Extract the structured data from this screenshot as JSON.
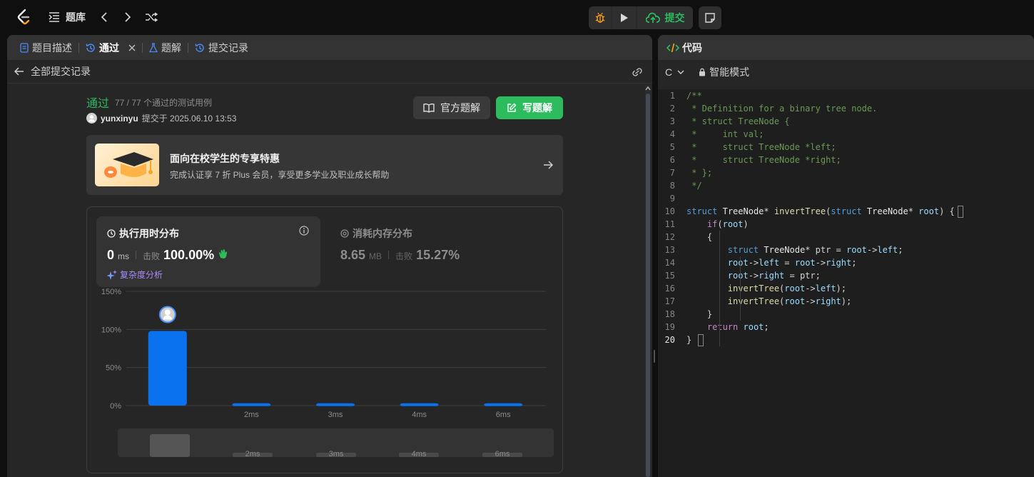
{
  "topbar": {
    "problem_bank": "题库",
    "submit": "提交",
    "colors": {
      "submit_green": "#2cbb5d",
      "debug_orange": "#ffa116"
    }
  },
  "tabs": [
    {
      "label": "题目描述",
      "icon": "doc-icon"
    },
    {
      "label": "通过",
      "icon": "history-icon",
      "active": true,
      "closable": true
    },
    {
      "label": "题解",
      "icon": "flask-icon"
    },
    {
      "label": "提交记录",
      "icon": "history-icon"
    }
  ],
  "subbar": {
    "back_label": "全部提交记录"
  },
  "submission": {
    "status": "通过",
    "cases": "77 / 77 个通过的测试用例",
    "user": "yunxinyu",
    "submitted_at": "提交于 2025.06.10 13:53",
    "official_solution": "官方题解",
    "write_solution": "写题解"
  },
  "promo": {
    "title": "面向在校学生的专享特惠",
    "desc": "完成认证享 7 折 Plus 会员，享受更多学业及职业成长帮助"
  },
  "runtime": {
    "title": "执行用时分布",
    "value": "0",
    "unit": "ms",
    "beats_label": "击败",
    "beats": "100.00%",
    "complexity": "复杂度分析"
  },
  "memory": {
    "title": "消耗内存分布",
    "value": "8.65",
    "unit": "MB",
    "beats_label": "击败",
    "beats": "15.27%"
  },
  "chart_data": {
    "type": "bar",
    "categories": [
      "",
      "2ms",
      "3ms",
      "4ms",
      "6ms"
    ],
    "values": [
      98,
      3,
      3,
      3,
      3
    ],
    "y_ticks": [
      "0%",
      "50%",
      "100%",
      "150%"
    ],
    "ylim": [
      0,
      150
    ],
    "grid": true,
    "bar_color": "#0a72ef",
    "minimap_labels": [
      "2ms",
      "3ms",
      "4ms",
      "6ms"
    ]
  },
  "editor": {
    "title": "代码",
    "language": "C",
    "mode": "智能模式",
    "lines": [
      "/**",
      " * Definition for a binary tree node.",
      " * struct TreeNode {",
      " *     int val;",
      " *     struct TreeNode *left;",
      " *     struct TreeNode *right;",
      " * };",
      " */",
      "",
      "struct TreeNode* invertTree(struct TreeNode* root) {",
      "    if(root)",
      "    {",
      "        struct TreeNode* ptr = root->left;",
      "        root->left = root->right;",
      "        root->right = ptr;",
      "        invertTree(root->left);",
      "        invertTree(root->right);",
      "    }",
      "    return root;",
      "}"
    ],
    "current_line": 20
  }
}
